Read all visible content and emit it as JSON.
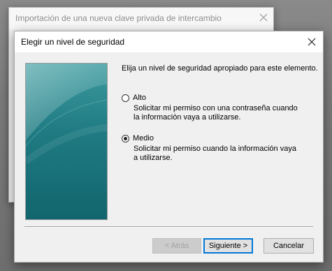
{
  "back_window": {
    "title": "Importación de una nueva clave privada de intercambio"
  },
  "dialog": {
    "title": "Elegir un nivel de seguridad",
    "instruction": "Elija un nivel de seguridad apropiado para este elemento.",
    "options": [
      {
        "label": "Alto",
        "description": "Solicitar mi permiso con una contraseña cuando la información vaya a utilizarse.",
        "selected": false
      },
      {
        "label": "Medio",
        "description": "Solicitar mi permiso cuando la información vaya a utilizarse.",
        "selected": true
      }
    ],
    "buttons": {
      "back": "< Atrás",
      "next": "Siguiente >",
      "cancel": "Cancelar"
    }
  },
  "icons": {
    "close": "close-icon",
    "side_art": "teal-gradient-illustration"
  },
  "colors": {
    "accent": "#0078d7",
    "side_art_teal": "#1b6f77"
  }
}
